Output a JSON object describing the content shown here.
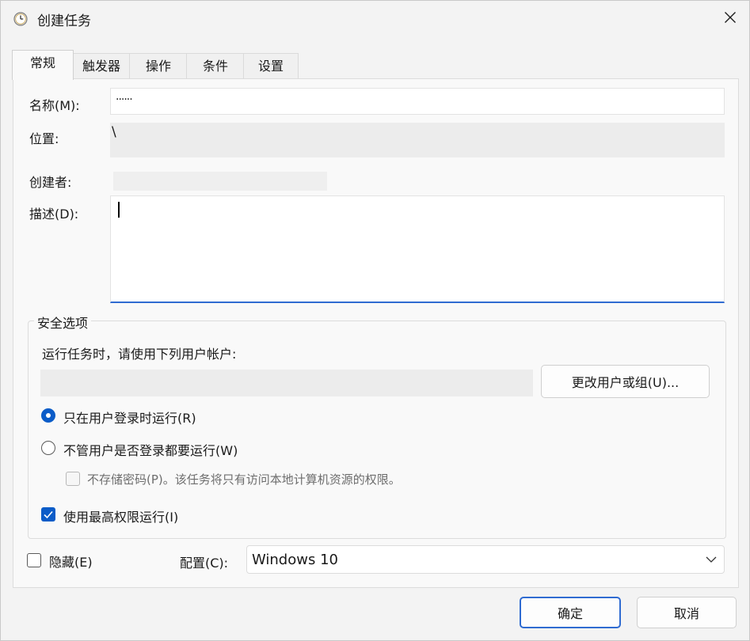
{
  "window": {
    "title": "创建任务"
  },
  "tabs": [
    {
      "label": "常规"
    },
    {
      "label": "触发器"
    },
    {
      "label": "操作"
    },
    {
      "label": "条件"
    },
    {
      "label": "设置"
    }
  ],
  "general": {
    "name_label": "名称(M):",
    "name_value": "······",
    "location_label": "位置:",
    "location_value": "\\",
    "author_label": "创建者:",
    "author_value": "",
    "description_label": "描述(D):",
    "description_value": ""
  },
  "security": {
    "group_label": "安全选项",
    "run_as_text": "运行任务时，请使用下列用户帐户:",
    "account_value": "",
    "change_user_button": "更改用户或组(U)...",
    "radio_logged_on": "只在用户登录时运行(R)",
    "radio_whether_logged": "不管用户是否登录都要运行(W)",
    "no_store_password": "不存储密码(P)。该任务将只有访问本地计算机资源的权限。",
    "highest_privileges": "使用最高权限运行(I)"
  },
  "bottom": {
    "hidden_label": "隐藏(E)",
    "configure_label": "配置(C):",
    "configure_value": "Windows 10"
  },
  "footer": {
    "ok_button": "确定",
    "cancel_button": "取消"
  },
  "colors": {
    "accent": "#0b5cc8",
    "input_underline": "#2f6bd1"
  },
  "icons": {
    "title": "task-scheduler-clock-icon",
    "close": "close-icon",
    "dropdown": "chevron-down-icon",
    "check": "checkmark-icon"
  }
}
